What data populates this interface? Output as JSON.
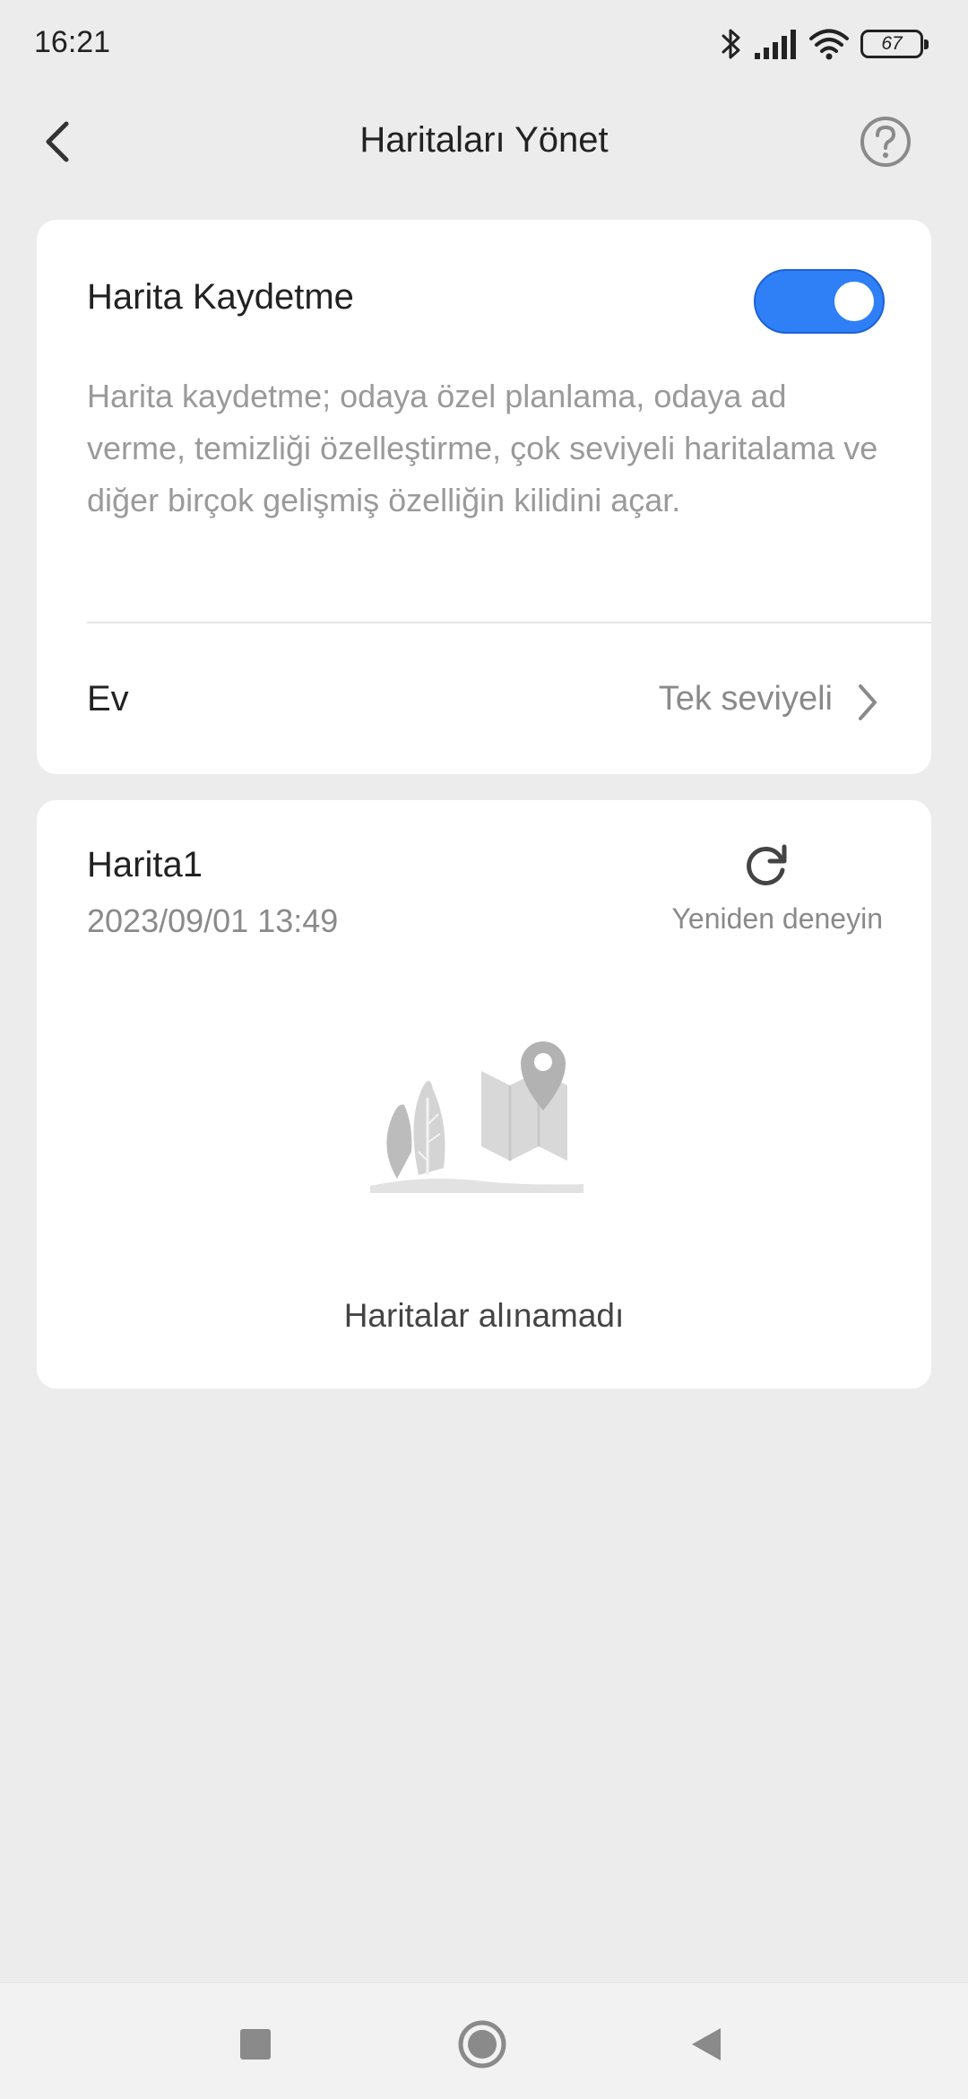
{
  "status_bar": {
    "time": "16:21",
    "battery_level": "67",
    "icons": [
      "bluetooth-icon",
      "signal-icon",
      "wifi-icon",
      "battery-icon"
    ]
  },
  "header": {
    "title": "Haritaları Yönet",
    "back_icon": "chevron-left-icon",
    "help_icon": "question-circle-icon"
  },
  "settings_card": {
    "map_saving_label": "Harita Kaydetme",
    "map_saving_enabled": true,
    "description": "Harita kaydetme; odaya özel planlama, odaya ad verme, temizliği özelleştirme, çok seviyeli haritalama ve diğer birçok gelişmiş özelliğin kilidini açar.",
    "home_label": "Ev",
    "home_value": "Tek seviyeli"
  },
  "map_card": {
    "map_name": "Harita1",
    "map_date": "2023/09/01 13:49",
    "retry_label": "Yeniden deneyin",
    "error_message": "Haritalar alınamadı"
  },
  "colors": {
    "accent": "#2f7ff7",
    "background": "#ececec",
    "card": "#ffffff",
    "secondary_text": "#9a9a9a"
  },
  "nav_bar": {
    "buttons": [
      "square-recent-icon",
      "circle-home-icon",
      "triangle-back-icon"
    ]
  }
}
